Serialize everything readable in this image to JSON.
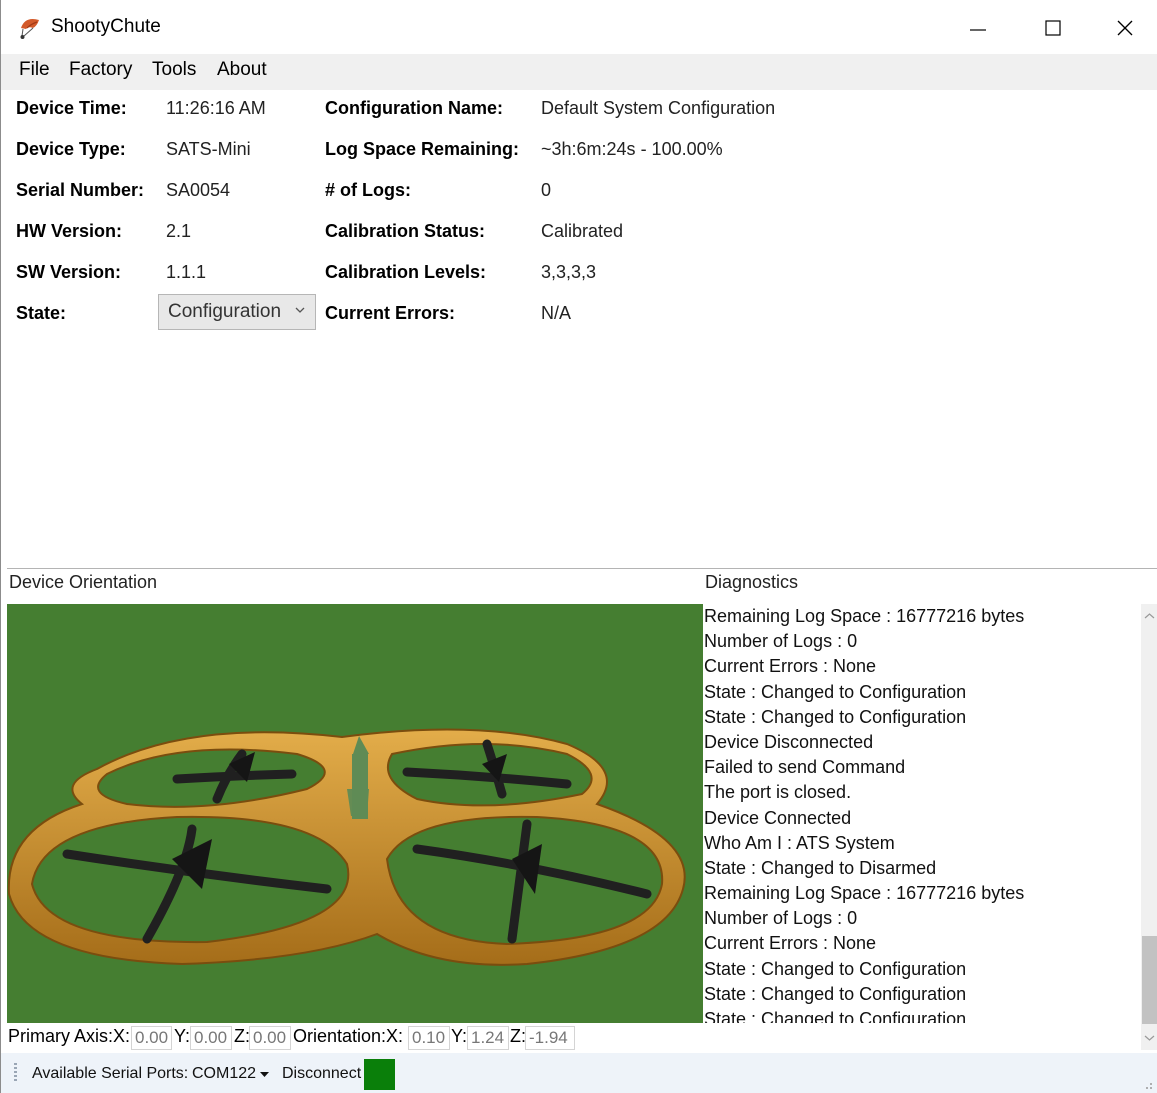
{
  "window": {
    "title": "ShootyChute"
  },
  "menu": [
    "File",
    "Factory",
    "Tools",
    "About"
  ],
  "device": {
    "device_time": {
      "label": "Device Time:",
      "value": "11:26:16 AM"
    },
    "device_type": {
      "label": "Device Type:",
      "value": "SATS-Mini"
    },
    "serial_number": {
      "label": "Serial Number:",
      "value": "SA0054"
    },
    "hw_version": {
      "label": "HW Version:",
      "value": "2.1"
    },
    "sw_version": {
      "label": "SW Version:",
      "value": "1.1.1"
    },
    "state": {
      "label": "State:",
      "value": "Configuration"
    }
  },
  "config": {
    "configuration_name": {
      "label": "Configuration Name:",
      "value": "Default System Configuration"
    },
    "log_space_remaining": {
      "label": "Log Space Remaining:",
      "value": "~3h:6m:24s - 100.00%"
    },
    "num_logs": {
      "label": "# of Logs:",
      "value": "0"
    },
    "calibration_status": {
      "label": "Calibration Status:",
      "value": "Calibrated"
    },
    "calibration_levels": {
      "label": "Calibration Levels:",
      "value": "3,3,3,3"
    },
    "current_errors": {
      "label": "Current Errors:",
      "value": "N/A"
    }
  },
  "orientation_panel": {
    "title": "Device Orientation"
  },
  "diagnostics": {
    "title": "Diagnostics",
    "lines": [
      "Remaining Log Space : 16777216 bytes",
      "Number of Logs : 0",
      "Current Errors : None",
      "State : Changed to Configuration",
      "State : Changed to Configuration",
      "Device Disconnected",
      "Failed to send Command",
      "The port is closed.",
      "Device Connected",
      "Who Am I : ATS System",
      "State : Changed to Disarmed",
      "Remaining Log Space : 16777216 bytes",
      "Number of Logs : 0",
      "Current Errors : None",
      "State : Changed to Configuration",
      "State : Changed to Configuration",
      "State : Changed to Configuration"
    ]
  },
  "axes": {
    "primary_label": "Primary Axis:X:",
    "orientation_label": "Orientation:X:",
    "y_label": "Y:",
    "z_label": "Z:",
    "primary": {
      "x": "0.00",
      "y": "0.00",
      "z": "0.00"
    },
    "orientation": {
      "x": "0.10",
      "y": "1.24",
      "z": "-1.94"
    }
  },
  "statusbar": {
    "ports_label": "Available Serial Ports:",
    "port_value": "COM122",
    "disconnect_label": "Disconnect",
    "indicator_color": "#0a7f0a"
  },
  "icons": {
    "app": "parachute-icon",
    "minimize": "minimize-icon",
    "maximize": "maximize-icon",
    "close": "close-icon"
  }
}
